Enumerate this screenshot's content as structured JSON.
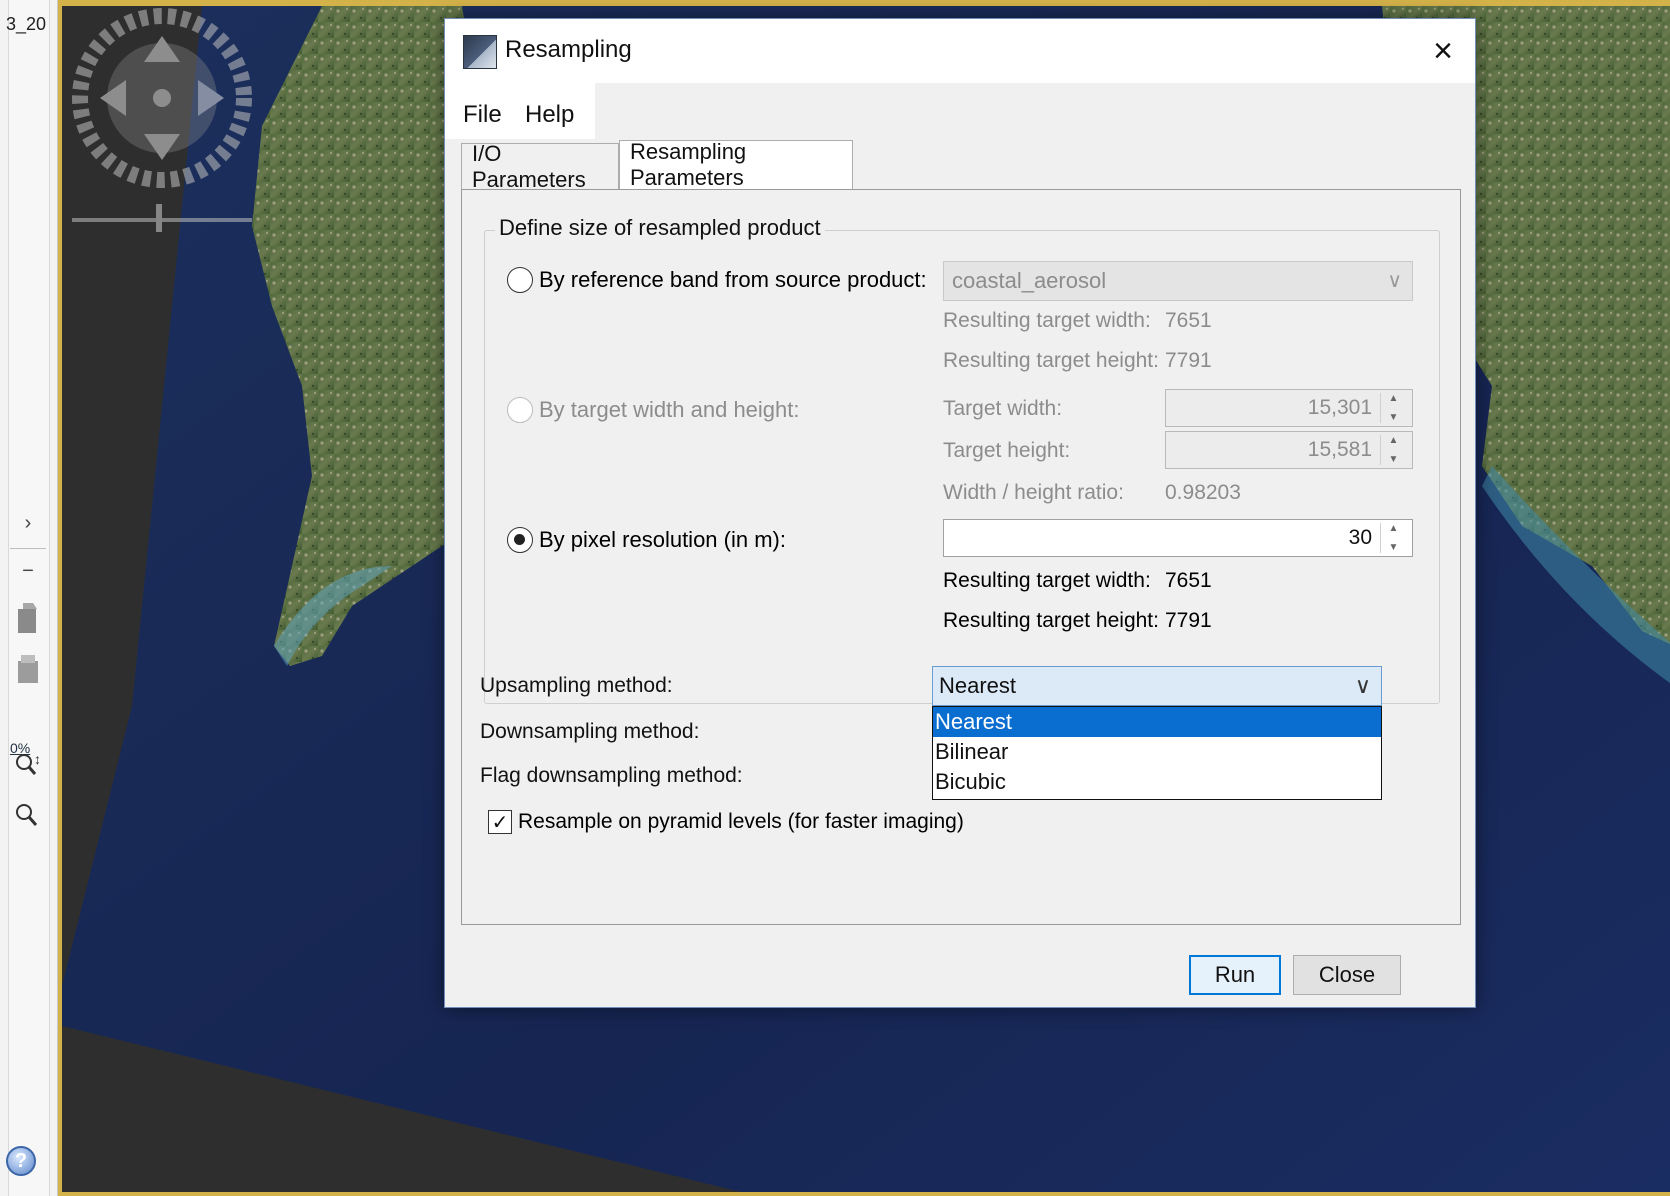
{
  "app": {
    "tab_label": "3_20",
    "zoom_percent": "0%"
  },
  "dialog": {
    "title": "Resampling",
    "close_glyph": "×",
    "menu": [
      "File",
      "Help"
    ],
    "tabs": [
      "I/O Parameters",
      "Resampling Parameters"
    ],
    "active_tab": "Resampling Parameters",
    "group_title": "Define size of resampled product",
    "by_reference": {
      "label": "By reference band from source product:",
      "band": "coastal_aerosol",
      "width_label": "Resulting target width:",
      "width_value": "7651",
      "height_label": "Resulting target height:",
      "height_value": "7791"
    },
    "by_size": {
      "label": "By target width and height:",
      "width_label": "Target width:",
      "width_value": "15,301",
      "height_label": "Target height:",
      "height_value": "15,581",
      "ratio_label": "Width / height ratio:",
      "ratio_value": "0.98203"
    },
    "by_resolution": {
      "label": "By pixel resolution (in m):",
      "value": "30",
      "width_label": "Resulting target width:",
      "width_value": "7651",
      "height_label": "Resulting target height:",
      "height_value": "7791"
    },
    "upsampling_label": "Upsampling method:",
    "upsampling_value": "Nearest",
    "downsampling_label": "Downsampling method:",
    "flag_downsampling_label": "Flag downsampling method:",
    "dropdown_options": [
      "Nearest",
      "Bilinear",
      "Bicubic"
    ],
    "dropdown_selected": "Nearest",
    "pyramid_label": "Resample on pyramid levels (for faster imaging)",
    "pyramid_checked": true,
    "run_label": "Run",
    "close_label": "Close"
  },
  "colors": {
    "selection": "#0a6ed1",
    "default_button_border": "#0078d7",
    "view_frame": "#d4b24a"
  },
  "icons": [
    "app-icon",
    "close-icon",
    "expand-icon",
    "collapse-icon",
    "layer-icon",
    "zoom-icon",
    "help-icon",
    "navigation-icon"
  ]
}
